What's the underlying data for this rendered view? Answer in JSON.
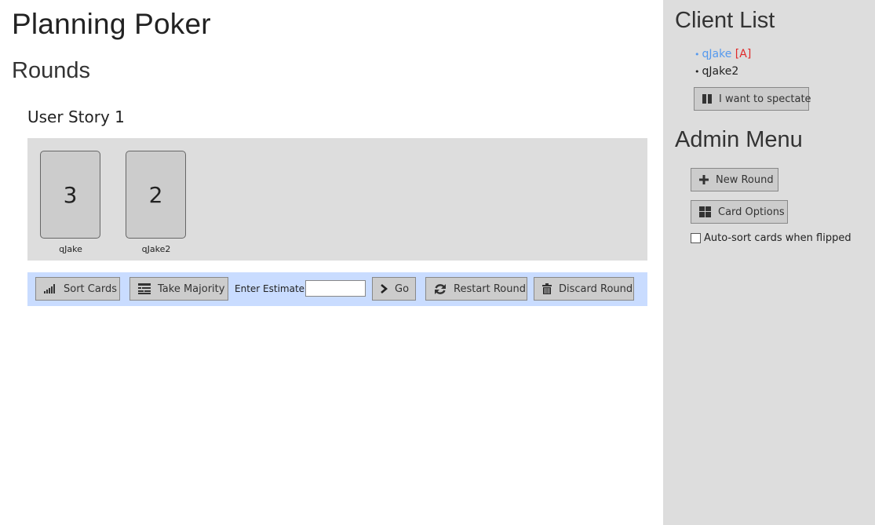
{
  "header": {
    "title": "Planning Poker",
    "section": "Rounds"
  },
  "round": {
    "title": "User Story 1",
    "cards": [
      {
        "value": "3",
        "owner": "qJake"
      },
      {
        "value": "2",
        "owner": "qJake2"
      }
    ]
  },
  "toolbar": {
    "sort_label": "Sort Cards",
    "majority_label": "Take Majority",
    "estimate_label": "Enter Estimate:",
    "estimate_value": "",
    "go_label": "Go",
    "restart_label": "Restart Round",
    "discard_label": "Discard Round"
  },
  "sidebar": {
    "client_list_title": "Client List",
    "clients": [
      {
        "bullet": "•",
        "name": "qJake",
        "badge": "[A]"
      },
      {
        "bullet": "•",
        "name": "qJake2",
        "badge": ""
      }
    ],
    "spectate_label": "I want to spectate",
    "admin_title": "Admin Menu",
    "new_round_label": "New Round",
    "card_options_label": "Card Options",
    "autosort_label": "Auto-sort cards when flipped",
    "autosort_checked": false
  },
  "icons": {
    "sort": "signal-bars-icon",
    "majority": "list-icon",
    "go": "chevron-right-icon",
    "restart": "refresh-icon",
    "discard": "trash-icon",
    "spectate": "pause-icon",
    "new_round": "plus-icon",
    "card_options": "grid-icon"
  },
  "colors": {
    "sidebar_bg": "#dddddd",
    "card_area_bg": "#dddddd",
    "toolbar_bg": "#c9dcff",
    "admin_name": "#5599ee",
    "admin_badge": "#e02828",
    "button_bg": "#cccccc"
  }
}
